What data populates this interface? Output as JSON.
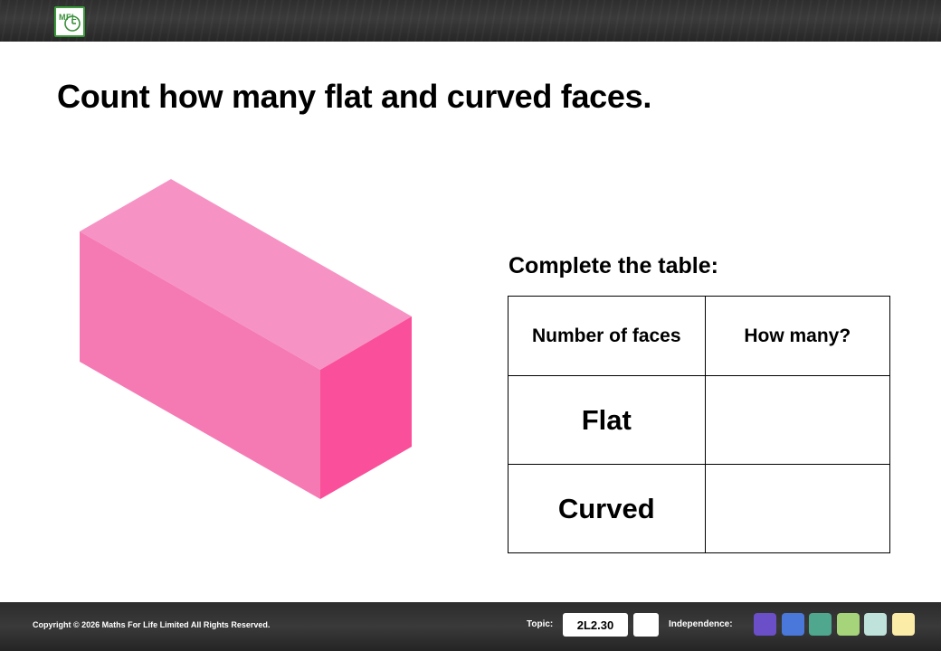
{
  "header": {
    "logo_text": "MFL",
    "logo_icon": "clock-icon"
  },
  "title": "Count how many flat and curved faces.",
  "shape": {
    "icon": "cuboid-shape",
    "colors": {
      "top": "#F693C4",
      "front": "#F57AB4",
      "side": "#FA4F9A"
    }
  },
  "table": {
    "caption": "Complete the table:",
    "headers": [
      "Number of faces",
      "How many?"
    ],
    "rows": [
      {
        "label": "Flat",
        "answer": ""
      },
      {
        "label": "Curved",
        "answer": ""
      }
    ]
  },
  "footer": {
    "copyright": "Copyright © 2026 Maths For Life Limited All Rights Reserved.",
    "topic_label": "Topic:",
    "topic_code": "2L2.30",
    "independence_label": "Independence:",
    "independence_colors": [
      "#6A4FC9",
      "#4A78DA",
      "#4FA88E",
      "#A6D47A",
      "#BFE3DA",
      "#FBECA8"
    ]
  }
}
